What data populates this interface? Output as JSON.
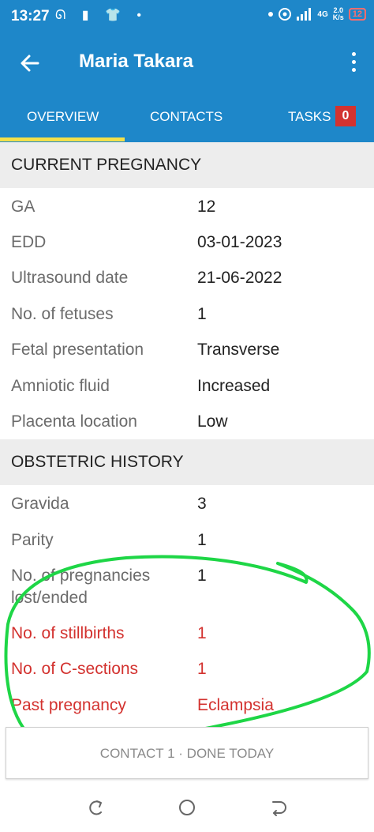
{
  "status_bar": {
    "time": "13:27",
    "left_icons": "ᘏ ▮ 👕 •",
    "network_type": "4G",
    "speed_value": "2.0",
    "speed_unit": "K/s",
    "battery": "12"
  },
  "app_bar": {
    "title": "Maria Takara"
  },
  "tabs": [
    {
      "label": "OVERVIEW",
      "selected": true
    },
    {
      "label": "CONTACTS",
      "selected": false
    },
    {
      "label": "TASKS",
      "selected": false,
      "badge": "0"
    }
  ],
  "current_pregnancy": {
    "header": "CURRENT PREGNANCY",
    "rows": [
      {
        "label": "GA",
        "value": "12"
      },
      {
        "label": "EDD",
        "value": "03-01-2023"
      },
      {
        "label": "Ultrasound date",
        "value": "21-06-2022"
      },
      {
        "label": "No. of fetuses",
        "value": "1"
      },
      {
        "label": "Fetal presentation",
        "value": "Transverse"
      },
      {
        "label": "Amniotic fluid",
        "value": "Increased"
      },
      {
        "label": "Placenta location",
        "value": "Low"
      }
    ]
  },
  "obstetric_history": {
    "header": "OBSTETRIC HISTORY",
    "rows": [
      {
        "label": "Gravida",
        "value": "3"
      },
      {
        "label": "Parity",
        "value": "1"
      },
      {
        "label": "No. of pregnancies",
        "label2": "lost/ended",
        "value": "1"
      },
      {
        "label": "No. of stillbirths",
        "value": "1"
      },
      {
        "label": "No. of C-sections",
        "value": "1"
      },
      {
        "label": "Past pregnancy",
        "value": "Eclampsia"
      }
    ]
  },
  "colors": {
    "primary": "#1e87c9",
    "tab_indicator": "#f3e04a",
    "alert_red": "#d3322f",
    "annotation_green": "#1ed646"
  },
  "contact_button": {
    "label": "CONTACT 1 · DONE TODAY"
  },
  "nav_icons": [
    "recents-icon",
    "home-icon",
    "back-nav-icon"
  ]
}
